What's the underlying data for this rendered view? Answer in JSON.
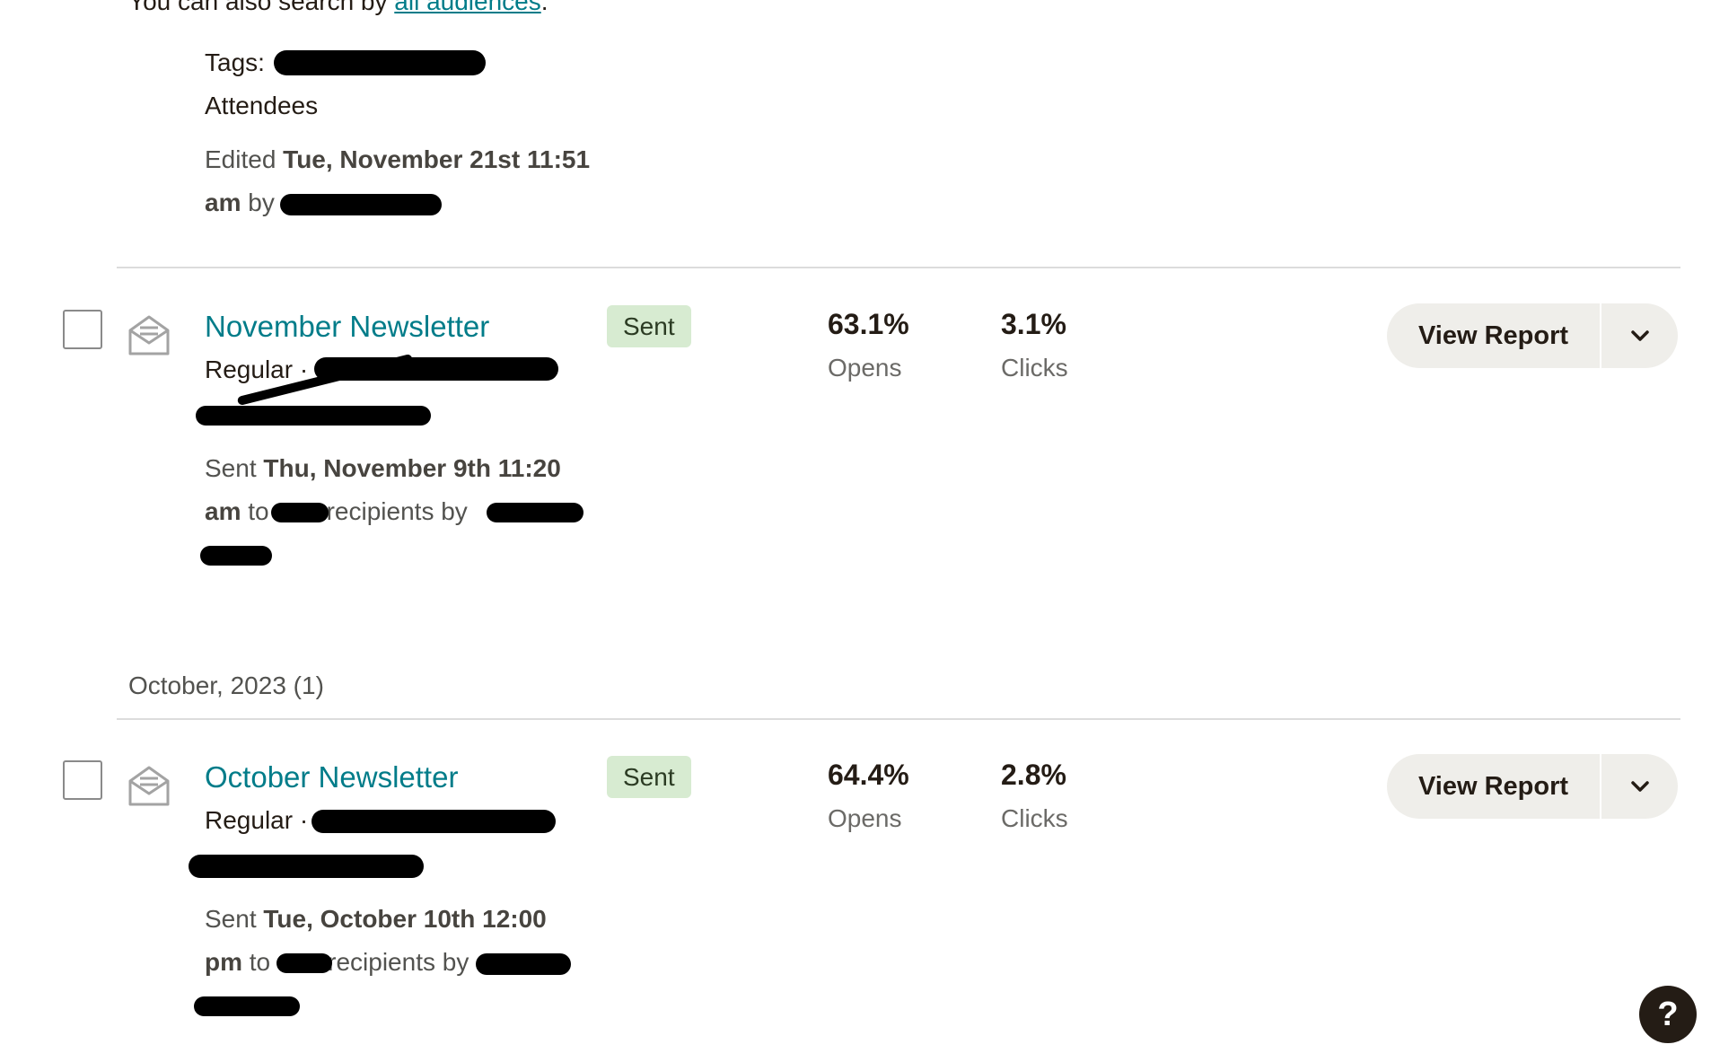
{
  "intro": {
    "prefix": "You can also search by ",
    "link": "all audiences",
    "suffix": "."
  },
  "draft": {
    "tags_label": "Tags: ",
    "tag_value": "Attendees",
    "edited_prefix": "Edited ",
    "edited_date": "Tue, November 21st 11:51",
    "edited_date2": "am",
    "edited_by": " by"
  },
  "campaigns": [
    {
      "title": "November Newsletter",
      "type": "Regular",
      "type_sep": " ·",
      "status": "Sent",
      "sent_prefix": "Sent ",
      "sent_date": "Thu, November 9th 11:20",
      "sent_date2": "am",
      "sent_to": " to",
      "recipients": "recipients by",
      "opens_value": "63.1%",
      "opens_label": "Opens",
      "clicks_value": "3.1%",
      "clicks_label": "Clicks",
      "action": "View Report"
    },
    {
      "title": "October Newsletter",
      "type": "Regular",
      "type_sep": " ·",
      "status": "Sent",
      "sent_prefix": "Sent ",
      "sent_date": "Tue, October 10th 12:00",
      "sent_date2": "pm",
      "sent_to": " to",
      "recipients": "recipients by",
      "opens_value": "64.4%",
      "opens_label": "Opens",
      "clicks_value": "2.8%",
      "clicks_label": "Clicks",
      "action": "View Report"
    }
  ],
  "group_header": "October, 2023 (1)",
  "help_label": "?",
  "icons": {
    "envelope": "envelope-open-icon",
    "chevron": "chevron-down-icon"
  }
}
